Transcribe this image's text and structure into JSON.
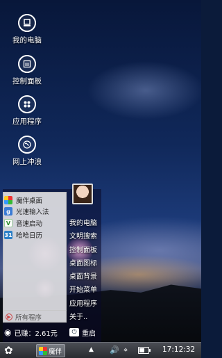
{
  "desktop_icons": [
    {
      "label": "我的电脑",
      "icon": "computer-icon"
    },
    {
      "label": "控制面板",
      "icon": "control-panel-icon"
    },
    {
      "label": "应用程序",
      "icon": "apps-icon"
    },
    {
      "label": "网上冲浪",
      "icon": "globe-icon"
    }
  ],
  "start_menu": {
    "items": [
      {
        "label": "魔伴桌面",
        "icon": "mobant-icon"
      },
      {
        "label": "光速输入法",
        "icon": "input-method-icon"
      },
      {
        "label": "音速启动",
        "icon": "launcher-icon"
      },
      {
        "label": "哈哈日历",
        "icon": "calendar-icon"
      }
    ],
    "all_programs": "所有程序",
    "right_items": [
      "我的电脑",
      "文明搜索",
      "控制面板",
      "桌面图标",
      "桌面背景",
      "开始菜单",
      "应用程序",
      "关于.."
    ],
    "earned_label": "已赚：2.61元",
    "restart_label": "重启"
  },
  "taskbar": {
    "task_label": "魔伴",
    "clock": "17:12:32",
    "battery_level": 0.55
  }
}
